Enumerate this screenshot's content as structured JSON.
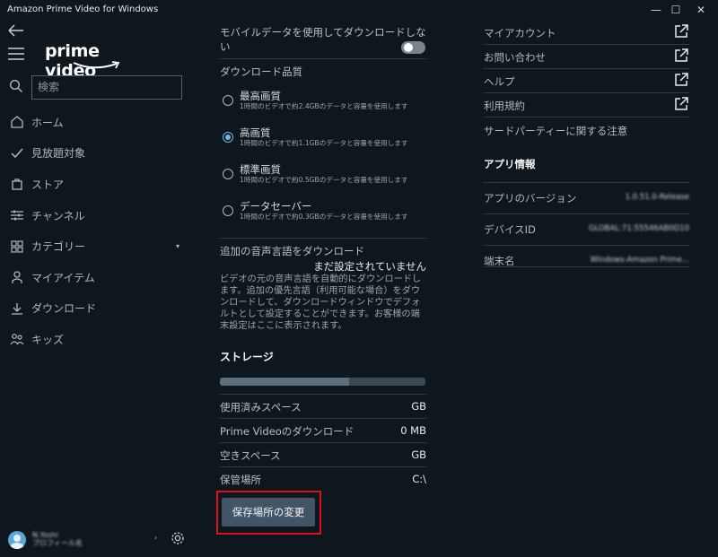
{
  "window": {
    "title": "Amazon Prime Video for Windows",
    "controls": {
      "minimize": "—",
      "maximize": "☐",
      "close": "✕"
    }
  },
  "sidebar": {
    "logo_text": "prime video",
    "search_placeholder": "検索",
    "items": [
      {
        "label": "ホーム",
        "icon": "home-icon"
      },
      {
        "label": "見放題対象",
        "icon": "check-icon"
      },
      {
        "label": "ストア",
        "icon": "shopping-bag-icon"
      },
      {
        "label": "チャンネル",
        "icon": "sliders-icon"
      },
      {
        "label": "カテゴリー",
        "icon": "grid-icon",
        "caret": "▾"
      },
      {
        "label": "マイアイテム",
        "icon": "person-icon"
      },
      {
        "label": "ダウンロード",
        "icon": "download-icon"
      },
      {
        "label": "キッズ",
        "icon": "kids-icon"
      }
    ],
    "profile": {
      "name_line1": "N.Yoshi",
      "name_line2": "プロフィール名",
      "arrow": "›"
    }
  },
  "settings": {
    "mobile_data_label": "モバイルデータを使用してダウンロードしない",
    "mobile_data_enabled": false,
    "download_quality_label": "ダウンロード品質",
    "quality_options": [
      {
        "title": "最高画質",
        "desc": "1時間のビデオで約2.4GBのデータと容量を使用します",
        "selected": false
      },
      {
        "title": "高画質",
        "desc": "1時間のビデオで約1.1GBのデータと容量を使用します",
        "selected": true
      },
      {
        "title": "標準画質",
        "desc": "1時間のビデオで約0.5GBのデータと容量を使用します",
        "selected": false
      },
      {
        "title": "データセーバー",
        "desc": "1時間のビデオで約0.3GBのデータと容量を使用します",
        "selected": false
      }
    ],
    "audio_label": "追加の音声言語をダウンロード",
    "audio_value": "まだ設定されていません",
    "audio_desc": "ビデオの元の音声言語を自動的にダウンロードします。追加の優先言語（利用可能な場合）をダウンロードして、ダウンロードウィンドウでデフォルトとして設定することができます。お客様の端末設定はここに表示されます。",
    "storage_heading": "ストレージ",
    "storage_used_fraction": 0.63,
    "storage_rows": [
      {
        "key": "使用済みスペース",
        "value": "GB"
      },
      {
        "key": "Prime Videoのダウンロード",
        "value": "0 MB"
      },
      {
        "key": "空きスペース",
        "value": "GB"
      },
      {
        "key": "保管場所",
        "value": "C:\\"
      }
    ],
    "change_location_button": "保存場所の変更"
  },
  "links": [
    {
      "label": "マイアカウント"
    },
    {
      "label": "お問い合わせ"
    },
    {
      "label": "ヘルプ"
    },
    {
      "label": "利用規約"
    }
  ],
  "third_party_notice": "サードパーティーに関する注意",
  "app_info": {
    "heading": "アプリ情報",
    "rows": [
      {
        "key": "アプリのバージョン",
        "value": "1.0.51.0-Release"
      },
      {
        "key": "デバイスID",
        "value": "GLOBAL:71:55546AB0D10"
      },
      {
        "key": "端末名",
        "value": "Windows-Amazon Prime..."
      }
    ]
  },
  "colors": {
    "background": "#0f171e",
    "accent": "#6fb6ec",
    "highlight_box": "#e0101a",
    "button": "#425566"
  }
}
